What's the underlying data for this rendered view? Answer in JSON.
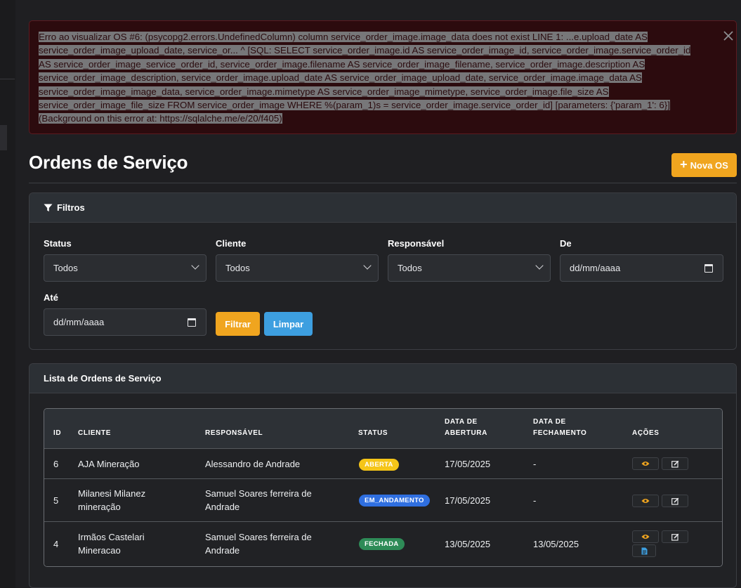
{
  "alert": {
    "message": "Erro ao visualizar OS #6: (psycopg2.errors.UndefinedColumn) column service_order_image.image_data does not exist LINE 1: ...e.upload_date AS service_order_image_upload_date, service_or... ^ [SQL: SELECT service_order_image.id AS service_order_image_id, service_order_image.service_order_id AS service_order_image_service_order_id, service_order_image.filename AS service_order_image_filename, service_order_image.description AS service_order_image_description, service_order_image.upload_date AS service_order_image_upload_date, service_order_image.image_data AS service_order_image_image_data, service_order_image.mimetype AS service_order_image_mimetype, service_order_image.file_size AS service_order_image_file_size FROM service_order_image WHERE %(param_1)s = service_order_image.service_order_id] [parameters: {'param_1': 6}] (Background on this error at: https://sqlalche.me/e/20/f405)",
    "close_symbol": "×"
  },
  "header": {
    "title": "Ordens de Serviço",
    "new_button": "Nova OS"
  },
  "filters": {
    "title": "Filtros",
    "status_label": "Status",
    "status_value": "Todos",
    "client_label": "Cliente",
    "client_value": "Todos",
    "responsible_label": "Responsável",
    "responsible_value": "Todos",
    "from_label": "De",
    "from_placeholder": "dd/mm/aaaa",
    "to_label": "Até",
    "to_placeholder": "dd/mm/aaaa",
    "filter_button": "Filtrar",
    "clear_button": "Limpar"
  },
  "list": {
    "title": "Lista de Ordens de Serviço",
    "columns": {
      "id": "ID",
      "client": "CLIENTE",
      "responsible": "RESPONSÁVEL",
      "status": "STATUS",
      "opened_l1": "DATA DE",
      "opened_l2": "ABERTURA",
      "closed_l1": "DATA DE",
      "closed_l2": "FECHAMENTO",
      "actions": "AÇÕES"
    },
    "rows": [
      {
        "id": "6",
        "client_l1": "AJA Mineração",
        "client_l2": "",
        "responsible_l1": "Alessandro de Andrade",
        "responsible_l2": "",
        "status": "ABERTA",
        "status_color": "#f5c518",
        "status_text_color": "#ffffff",
        "opened": "17/05/2025",
        "closed": "-"
      },
      {
        "id": "5",
        "client_l1": "Milanesi Milanez",
        "client_l2": "mineração",
        "responsible_l1": "Samuel Soares ferreira de",
        "responsible_l2": "Andrade",
        "status": "EM_ANDAMENTO",
        "status_color": "#2f6fe0",
        "status_text_color": "#ffffff",
        "opened": "17/05/2025",
        "closed": "-"
      },
      {
        "id": "4",
        "client_l1": "Irmãos Castelari",
        "client_l2": "Mineracao",
        "responsible_l1": "Samuel Soares ferreira de",
        "responsible_l2": "Andrade",
        "status": "FECHADA",
        "status_color": "#2e8b57",
        "status_text_color": "#ffffff",
        "opened": "13/05/2025",
        "closed": "13/05/2025"
      }
    ]
  },
  "colors": {
    "accent": "#f0a51f",
    "info": "#3d9fe0",
    "alert_bg": "#2c0b0e"
  }
}
